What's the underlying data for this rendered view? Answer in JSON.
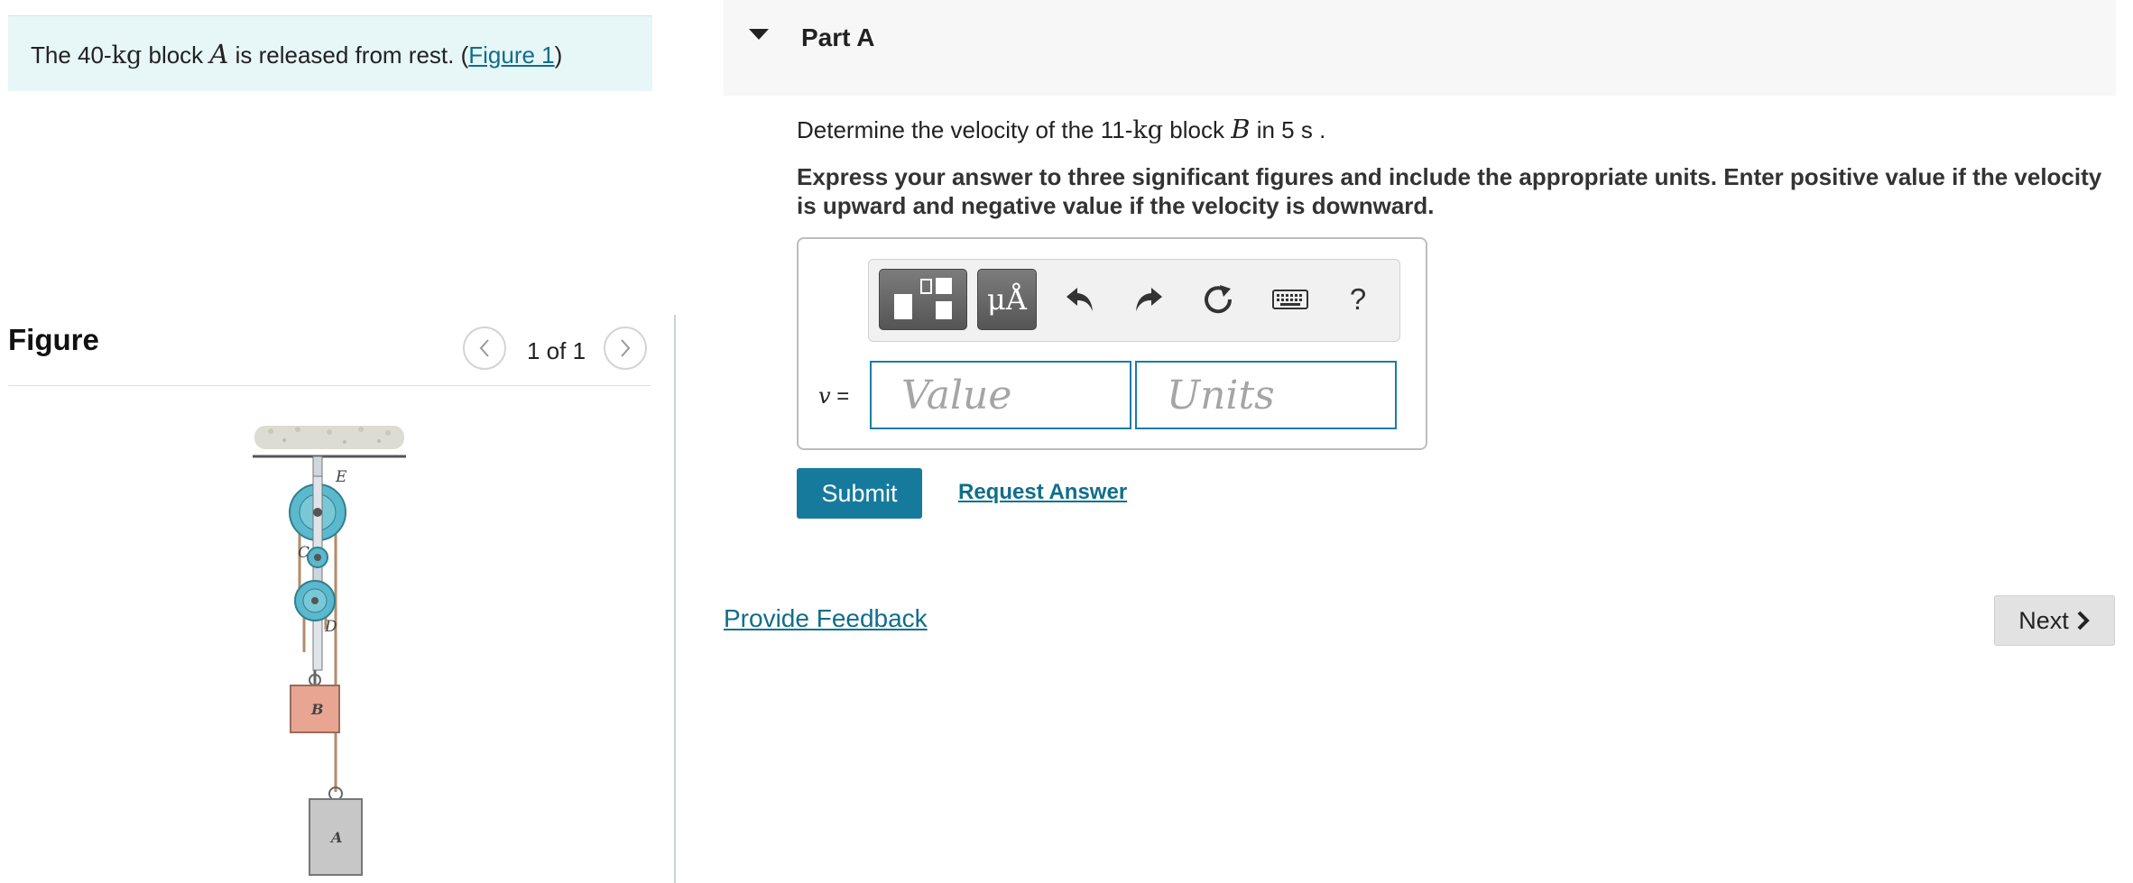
{
  "problem": {
    "text_before": "The 40-",
    "mass_unit": "kg",
    "text_mid": " block ",
    "block_letter": "A",
    "text_after": " is released from rest. (",
    "figure_link": "Figure 1",
    "text_close": ")"
  },
  "figure": {
    "title": "Figure",
    "counter": "1 of 1",
    "labels": {
      "E": "E",
      "C": "C",
      "D": "D",
      "B": "B",
      "A": "A"
    },
    "colors": {
      "pulley": "#5cb8cc",
      "block_b": "#e8a591",
      "block_a": "#c7c7c7",
      "rope": "#b08d6a",
      "ceiling": "#d9d9d0"
    }
  },
  "part": {
    "title": "Part A",
    "question_before": "Determine the velocity of the 11-",
    "question_unit": "kg",
    "question_mid": " block ",
    "question_letter": "B",
    "question_after": " in 5  s .",
    "instructions": "Express your answer to three significant figures and include the appropriate units. Enter positive value if the velocity is upward and negative value if the velocity is downward."
  },
  "answer": {
    "toolbar": {
      "templates_icon": "templates-icon",
      "units_symbol": "μÅ",
      "undo_icon": "undo-icon",
      "redo_icon": "redo-icon",
      "reset_icon": "reset-icon",
      "keyboard_icon": "keyboard-icon",
      "help": "?"
    },
    "variable": "v",
    "equals": " =",
    "value_placeholder": "Value",
    "units_placeholder": "Units",
    "submit_label": "Submit",
    "request_answer_label": "Request Answer"
  },
  "footer": {
    "feedback_label": "Provide Feedback",
    "next_label": "Next"
  },
  "theme": {
    "accent": "#167a9d",
    "link": "#0f6e8c",
    "problem_bg": "#e7f6f7"
  }
}
